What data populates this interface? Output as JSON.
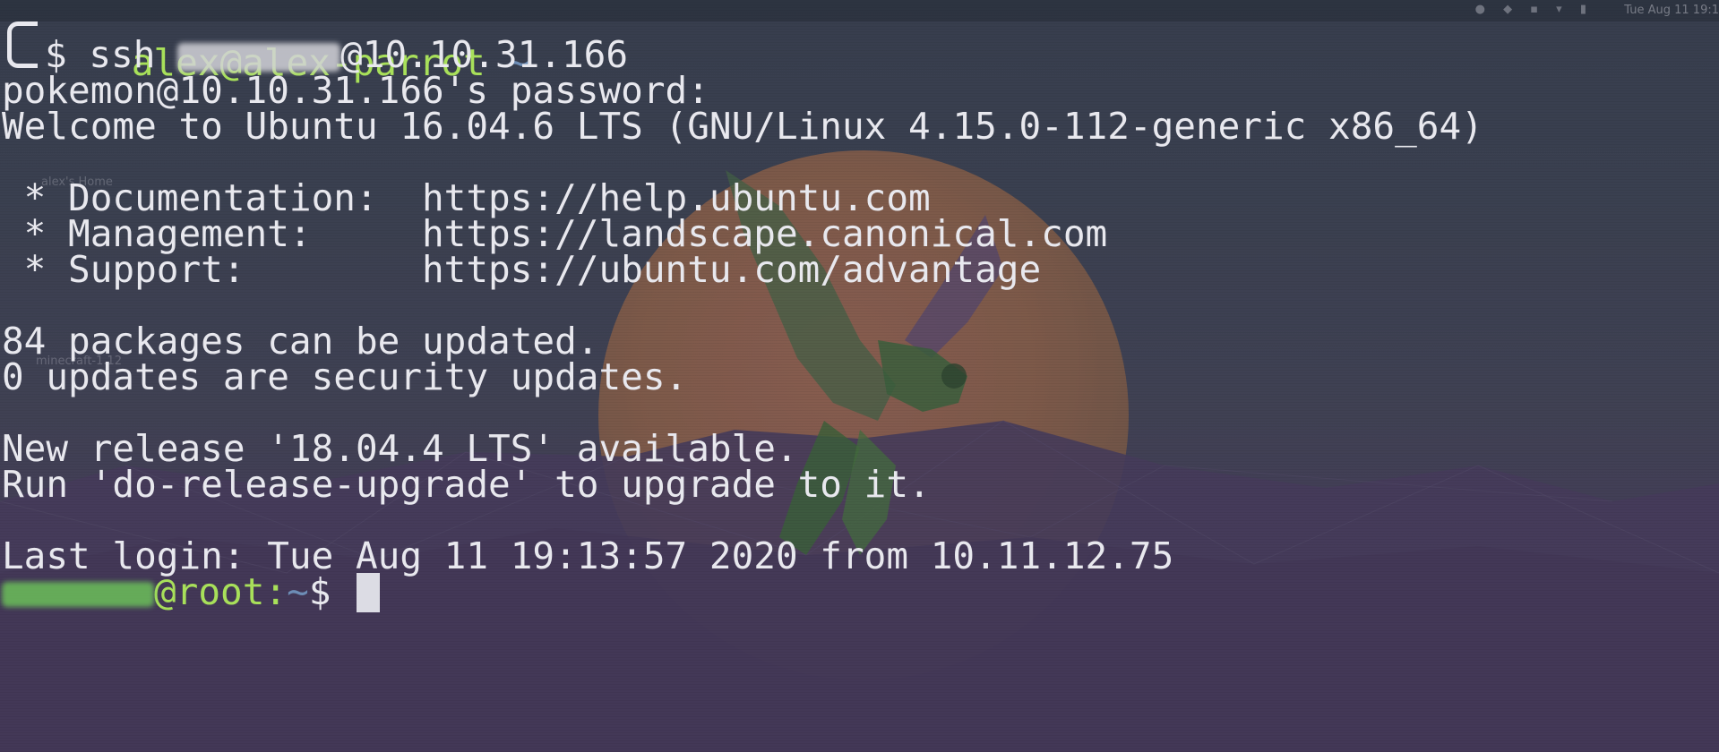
{
  "colors": {
    "prompt_green": "#a8e05a",
    "tilde_blue": "#6d8db6",
    "text": "#e8e8ee",
    "cursor": "#dcdce4"
  },
  "desktop": {
    "labels": [
      "alex's Home",
      "minecraft-1.12"
    ],
    "panel_clock": "Tue Aug 11 19:1"
  },
  "prompt": {
    "user_host": "alex@alex-parrot",
    "cwd": "~",
    "symbol": "$",
    "command_prefix": "ssh ",
    "command_suffix": "@10.10.31.166"
  },
  "output": {
    "password_prompt": "pokemon@10.10.31.166's password:",
    "welcome": "Welcome to Ubuntu 16.04.6 LTS (GNU/Linux 4.15.0-112-generic x86_64)",
    "doc_label": " * Documentation:  ",
    "doc_url": "https://help.ubuntu.com",
    "mgmt_label": " * Management:     ",
    "mgmt_url": "https://landscape.canonical.com",
    "support_label": " * Support:        ",
    "support_url": "https://ubuntu.com/advantage",
    "packages": "84 packages can be updated.",
    "security": "0 updates are security updates.",
    "release": "New release '18.04.4 LTS' available.",
    "upgrade": "Run 'do-release-upgrade' to upgrade to it.",
    "last_login": "Last login: Tue Aug 11 19:13:57 2020 from 10.11.12.75"
  },
  "remote_prompt": {
    "host_path": "@root:",
    "cwd": "~",
    "symbol": "$ "
  }
}
